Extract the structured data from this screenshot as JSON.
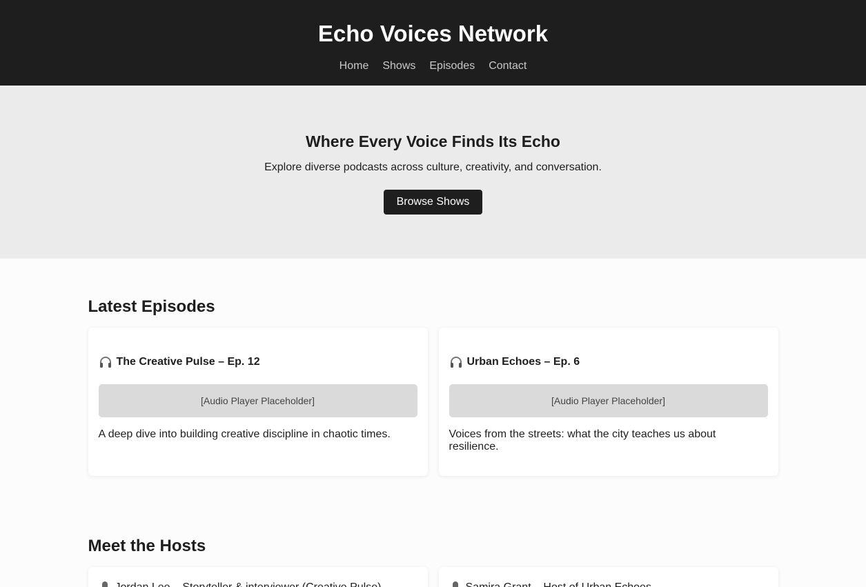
{
  "header": {
    "title": "Echo Voices Network",
    "nav": [
      "Home",
      "Shows",
      "Episodes",
      "Contact"
    ]
  },
  "hero": {
    "title": "Where Every Voice Finds Its Echo",
    "subtitle": "Explore diverse podcasts across culture, creativity, and conversation.",
    "button": "Browse Shows"
  },
  "episodes": {
    "title": "Latest Episodes",
    "items": [
      {
        "icon": "headphones-icon",
        "title": "The Creative Pulse – Ep. 12",
        "player": "[Audio Player Placeholder]",
        "description": "A deep dive into building creative discipline in chaotic times."
      },
      {
        "icon": "headphones-icon",
        "title": "Urban Echoes – Ep. 6",
        "player": "[Audio Player Placeholder]",
        "description": "Voices from the streets: what the city teaches us about resilience."
      }
    ]
  },
  "hosts": {
    "title": "Meet the Hosts",
    "items": [
      {
        "icon": "microphone-icon",
        "text": "Jordan Lee – Storyteller & interviewer (Creative Pulse)"
      },
      {
        "icon": "microphone-icon",
        "text": "Samira Grant – Host of Urban Echoes"
      }
    ]
  },
  "colors": {
    "header_bg": "#1e1e1e",
    "hero_bg": "#ebebeb",
    "button_bg": "#1e1e1e",
    "player_bg": "#dadada"
  }
}
